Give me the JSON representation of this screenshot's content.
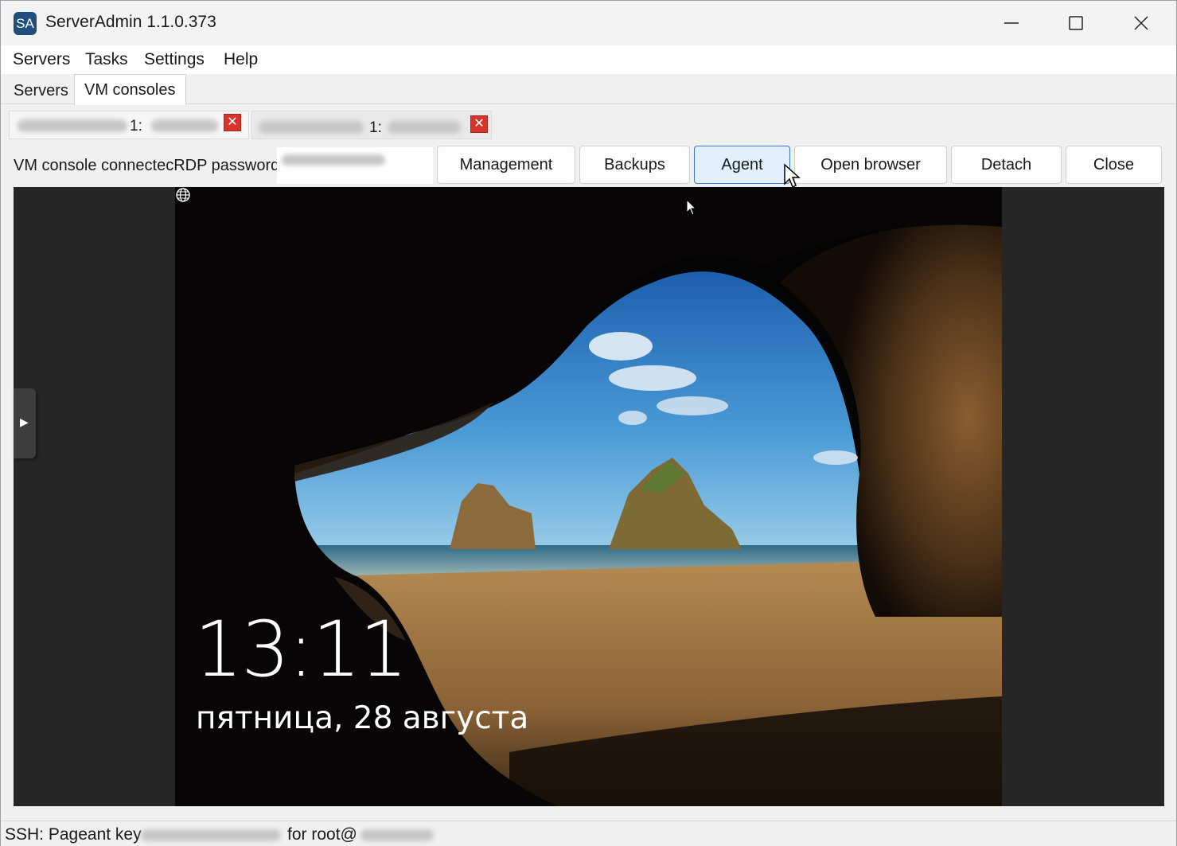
{
  "window": {
    "title": "ServerAdmin 1.1.0.373",
    "icon_text": "SA",
    "minimize": "—",
    "maximize": "☐",
    "close": "✕"
  },
  "menu": [
    "Servers",
    "Tasks",
    "Settings",
    "Help"
  ],
  "tabs": [
    {
      "label": "Servers",
      "active": false
    },
    {
      "label": "VM consoles",
      "active": true
    }
  ],
  "console_tabs": [
    {
      "number": "1:",
      "close": "✕",
      "active": true
    },
    {
      "number": "1:",
      "close": "✕",
      "active": false
    }
  ],
  "toolbar": {
    "status_label": "VM console connectecRDP password",
    "buttons": {
      "management": "Management",
      "backups": "Backups",
      "agent": "Agent",
      "open_browser": "Open browser",
      "detach": "Detach",
      "close": "Close"
    }
  },
  "console": {
    "clock": "13:11",
    "date": "пятница, 28 августа",
    "side_handle_icon": "play-right-icon",
    "tray_icon": "globe-icon"
  },
  "status_bar": {
    "prefix": "SSH: Pageant key",
    "middle": "for root@"
  },
  "colors": {
    "accent_button": "#e2efff",
    "accent_border": "#3b78d4",
    "close_tab": "#d9342b",
    "console_bg": "#262626"
  }
}
